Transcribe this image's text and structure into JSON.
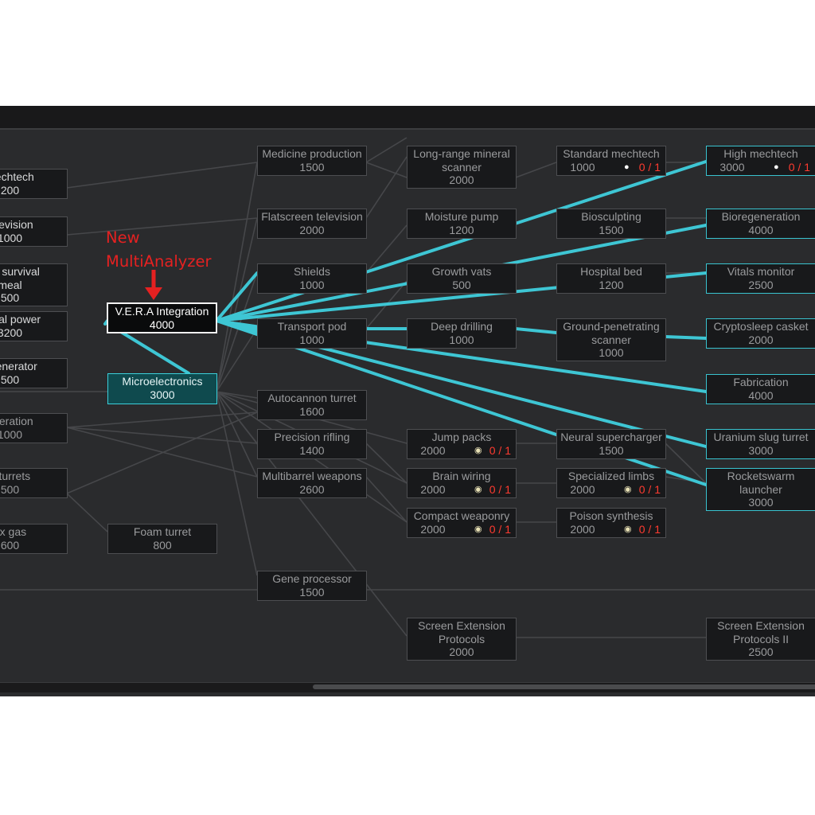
{
  "annotation": {
    "line1": "New",
    "line2": "MultiAnalyzer"
  },
  "colors": {
    "panel": "#2a2b2d",
    "node": "#18191b",
    "highlight_line": "#3ec6d4",
    "researched": "#0f4a4e",
    "prereq_missing": "#ff3b30",
    "annotation": "#e52121"
  },
  "nodes": {
    "mechtech": {
      "title": "mechtech",
      "cost": "200"
    },
    "television": {
      "title": "television",
      "cost": "1000"
    },
    "survival_meal": {
      "title1": "ged survival",
      "title2": "meal",
      "cost": "500"
    },
    "thermal_power": {
      "title": "ermal power",
      "cost": "3200"
    },
    "generator": {
      "title": "r generator",
      "cost": "500"
    },
    "cooperation": {
      "title": "operation",
      "cost": "1000"
    },
    "turrets": {
      "title": "n turrets",
      "cost": "500"
    },
    "tox_gas": {
      "title": "ox gas",
      "cost": "600"
    },
    "vera": {
      "title": "V.E.R.A Integration",
      "cost": "4000"
    },
    "microelectronics": {
      "title": "Microelectronics",
      "cost": "3000"
    },
    "foam_turret": {
      "title": "Foam turret",
      "cost": "800"
    },
    "medicine_production": {
      "title": "Medicine production",
      "cost": "1500"
    },
    "flatscreen_television": {
      "title": "Flatscreen television",
      "cost": "2000"
    },
    "shields": {
      "title": "Shields",
      "cost": "1000"
    },
    "transport_pod": {
      "title": "Transport pod",
      "cost": "1000"
    },
    "autocannon_turret": {
      "title": "Autocannon turret",
      "cost": "1600"
    },
    "precision_rifling": {
      "title": "Precision rifling",
      "cost": "1400"
    },
    "multibarrel_weapons": {
      "title": "Multibarrel weapons",
      "cost": "2600"
    },
    "gene_processor": {
      "title": "Gene processor",
      "cost": "1500"
    },
    "long_range_scanner": {
      "title1": "Long-range mineral",
      "title2": "scanner",
      "cost": "2000"
    },
    "moisture_pump": {
      "title": "Moisture pump",
      "cost": "1200"
    },
    "growth_vats": {
      "title": "Growth vats",
      "cost": "500"
    },
    "deep_drilling": {
      "title": "Deep drilling",
      "cost": "1000"
    },
    "jump_packs": {
      "title": "Jump packs",
      "cost": "2000",
      "prereq": "0 / 1"
    },
    "brain_wiring": {
      "title": "Brain wiring",
      "cost": "2000",
      "prereq": "0 / 1"
    },
    "compact_weaponry": {
      "title": "Compact weaponry",
      "cost": "2000",
      "prereq": "0 / 1"
    },
    "screen_ext": {
      "title1": "Screen Extension",
      "title2": "Protocols",
      "cost": "2000"
    },
    "standard_mechtech": {
      "title": "Standard mechtech",
      "cost": "1000",
      "prereq": "0 / 1"
    },
    "biosculpting": {
      "title": "Biosculpting",
      "cost": "1500"
    },
    "hospital_bed": {
      "title": "Hospital bed",
      "cost": "1200"
    },
    "ground_scanner": {
      "title1": "Ground-penetrating",
      "title2": "scanner",
      "cost": "1000"
    },
    "neural_supercharger": {
      "title": "Neural supercharger",
      "cost": "1500"
    },
    "specialized_limbs": {
      "title": "Specialized limbs",
      "cost": "2000",
      "prereq": "0 / 1"
    },
    "poison_synthesis": {
      "title": "Poison synthesis",
      "cost": "2000",
      "prereq": "0 / 1"
    },
    "high_mechtech": {
      "title": "High mechtech",
      "cost": "3000",
      "prereq": "0 / 1"
    },
    "bioregeneration": {
      "title": "Bioregeneration",
      "cost": "4000"
    },
    "vitals_monitor": {
      "title": "Vitals monitor",
      "cost": "2500"
    },
    "cryptosleep_casket": {
      "title": "Cryptosleep casket",
      "cost": "2000"
    },
    "fabrication": {
      "title": "Fabrication",
      "cost": "4000"
    },
    "uranium_slug_turret": {
      "title": "Uranium slug turret",
      "cost": "3000"
    },
    "rocketswarm_launcher": {
      "title1": "Rocketswarm",
      "title2": "launcher",
      "cost": "3000"
    },
    "screen_ext_2": {
      "title1": "Screen Extension",
      "title2": "Protocols II",
      "cost": "2500"
    }
  }
}
